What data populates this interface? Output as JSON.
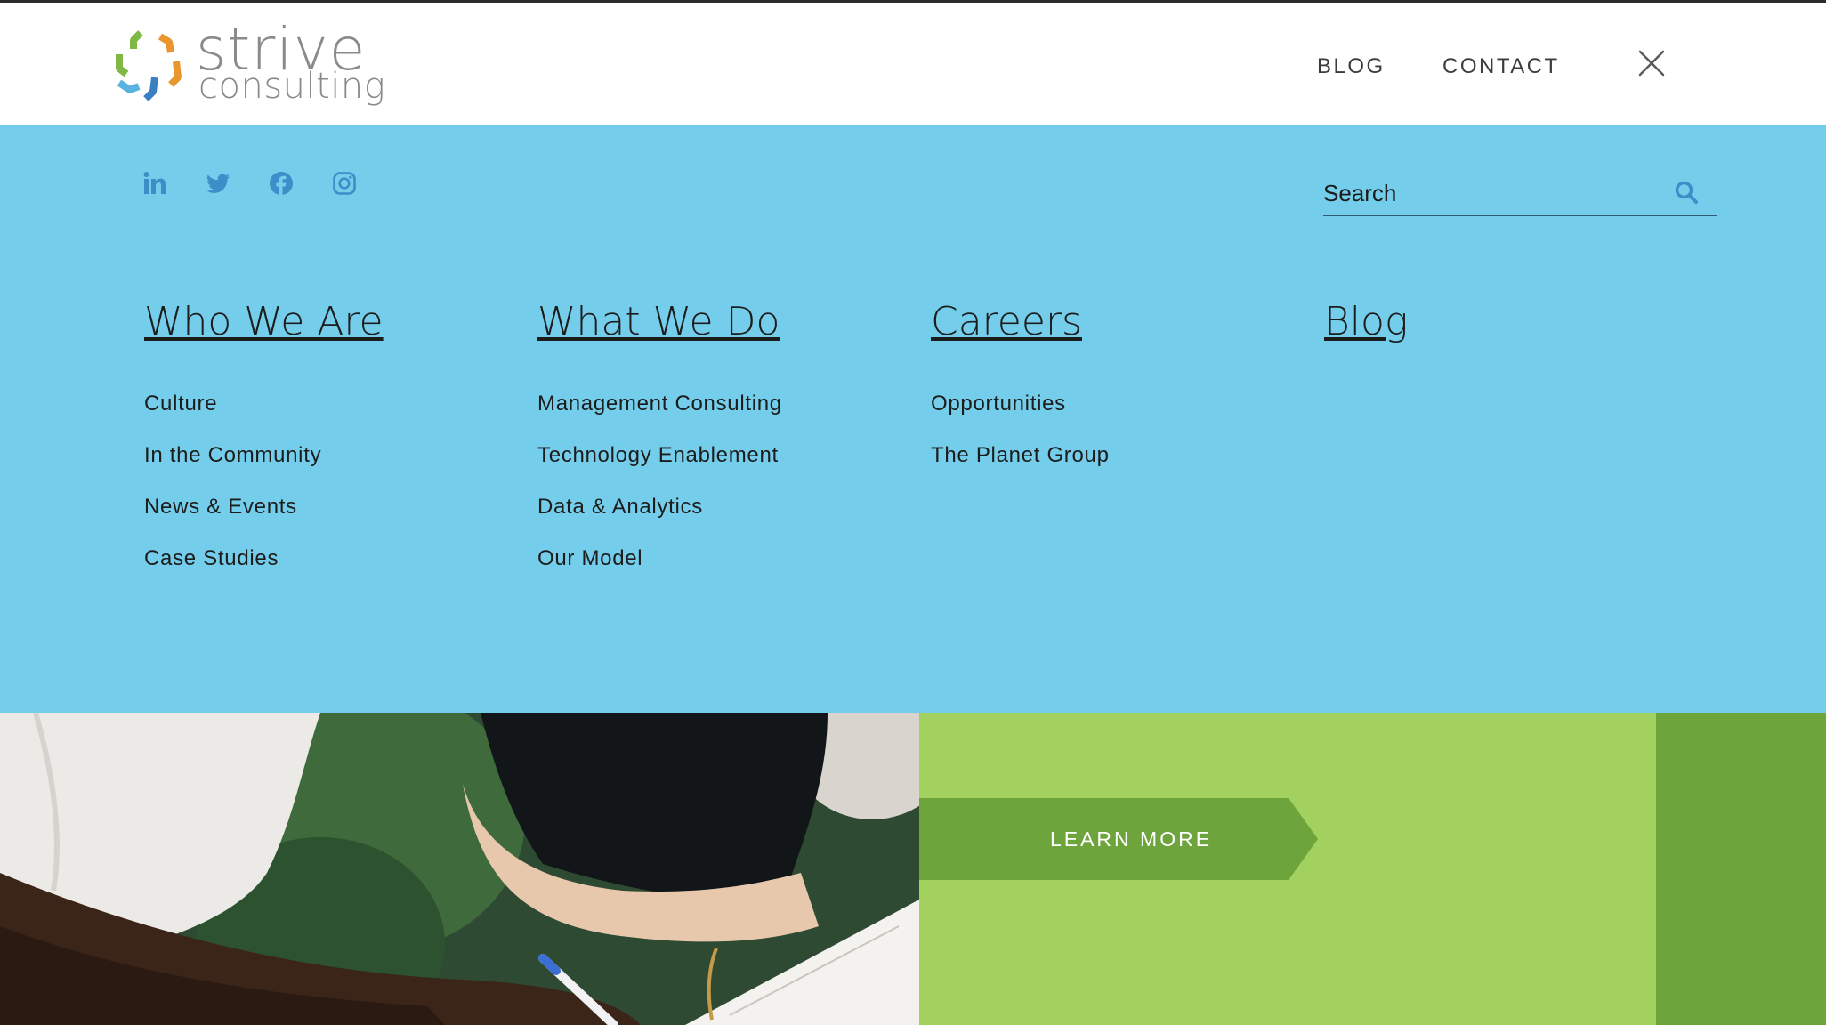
{
  "logo": {
    "word1": "strive",
    "word2": "consulting"
  },
  "header": {
    "nav": [
      "BLOG",
      "CONTACT"
    ]
  },
  "social": [
    "linkedin-icon",
    "twitter-icon",
    "facebook-icon",
    "instagram-icon"
  ],
  "search": {
    "placeholder": "Search"
  },
  "menu": {
    "columns": [
      {
        "title": "Who We Are",
        "links": [
          "Culture",
          "In the Community",
          "News & Events",
          "Case Studies"
        ]
      },
      {
        "title": "What We Do",
        "links": [
          "Management Consulting",
          "Technology Enablement",
          "Data & Analytics",
          "Our Model"
        ]
      },
      {
        "title": "Careers",
        "links": [
          "Opportunities",
          "The Planet Group"
        ]
      },
      {
        "title": "Blog",
        "links": []
      }
    ]
  },
  "cta": {
    "label": "LEARN MORE"
  },
  "colors": {
    "menu_bg": "#74cdea",
    "social_icon": "#3a8fc8",
    "green_light": "#a3d160",
    "green_dark": "#6ea43c",
    "button_bg": "#6ea43c"
  }
}
